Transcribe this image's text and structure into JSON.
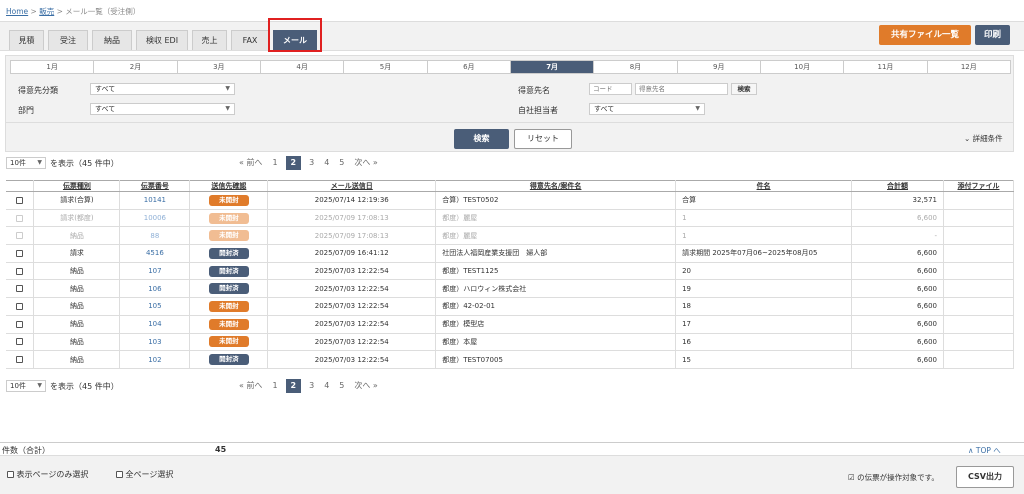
{
  "breadcrumb": {
    "home": "Home",
    "sales": "販売",
    "current": "メール一覧（受注側）"
  },
  "tabs": [
    "見積",
    "受注",
    "納品",
    "検収 EDI",
    "売上",
    "FAX",
    "メール"
  ],
  "active_tab": "メール",
  "buttons": {
    "shared_files": "共有ファイル一覧",
    "print": "印刷",
    "search": "検索",
    "reset": "リセット",
    "detail": "詳細条件",
    "csv": "CSV出力",
    "code_search": "検索"
  },
  "months": [
    "1月",
    "2月",
    "3月",
    "4月",
    "5月",
    "6月",
    "7月",
    "8月",
    "9月",
    "10月",
    "11月",
    "12月"
  ],
  "active_month": "7月",
  "filters": {
    "customer_category_label": "得意先分類",
    "customer_category_value": "すべて",
    "department_label": "部門",
    "department_value": "すべて",
    "customer_name_label": "得意先名",
    "code_placeholder": "コード",
    "name_placeholder": "得意先名",
    "staff_label": "自社担当者",
    "staff_value": "すべて"
  },
  "pagination": {
    "per_page": "10件",
    "display_label": "を表示（45 件中）",
    "prev": "« 前へ",
    "next": "次へ »",
    "pages": [
      "1",
      "2",
      "3",
      "4",
      "5"
    ],
    "current": "2"
  },
  "table": {
    "headers": [
      "伝票種別",
      "伝票番号",
      "送信先確認",
      "メール送信日",
      "得意先名/案件名",
      "件名",
      "合計額",
      "添付ファイル"
    ],
    "rows": [
      {
        "type": "請求(合算)",
        "no": "10141",
        "status": "未開封",
        "status_kind": "unread",
        "date": "2025/07/14 12:19:36",
        "customer": "合算）TEST0502",
        "subject": "合算",
        "total": "32,571",
        "attach": "",
        "dim": false
      },
      {
        "type": "請求(都度)",
        "no": "10006",
        "status": "未開封",
        "status_kind": "unread",
        "date": "2025/07/09 17:08:13",
        "customer": "都度）麗屋",
        "subject": "1",
        "total": "6,600",
        "attach": "",
        "dim": true
      },
      {
        "type": "納品",
        "no": "88",
        "status": "未開封",
        "status_kind": "unread",
        "date": "2025/07/09 17:08:13",
        "customer": "都度）麗屋",
        "subject": "1",
        "total": "-",
        "attach": "",
        "dim": true
      },
      {
        "type": "請求",
        "no": "4516",
        "status": "開封済",
        "status_kind": "read",
        "date": "2025/07/09 16:41:12",
        "customer": "社団法人福岡産業支援団　婦人部",
        "subject": "請求期間 2025年07月06~2025年08月05",
        "total": "6,600",
        "attach": "",
        "dim": false
      },
      {
        "type": "納品",
        "no": "107",
        "status": "開封済",
        "status_kind": "read",
        "date": "2025/07/03 12:22:54",
        "customer": "都度）TEST1125",
        "subject": "20",
        "total": "6,600",
        "attach": "",
        "dim": false
      },
      {
        "type": "納品",
        "no": "106",
        "status": "開封済",
        "status_kind": "read",
        "date": "2025/07/03 12:22:54",
        "customer": "都度）ハロウィン株式会社",
        "subject": "19",
        "total": "6,600",
        "attach": "",
        "dim": false
      },
      {
        "type": "納品",
        "no": "105",
        "status": "未開封",
        "status_kind": "unread",
        "date": "2025/07/03 12:22:54",
        "customer": "都度）42-02-01",
        "subject": "18",
        "total": "6,600",
        "attach": "",
        "dim": false
      },
      {
        "type": "納品",
        "no": "104",
        "status": "未開封",
        "status_kind": "unread",
        "date": "2025/07/03 12:22:54",
        "customer": "都度）模型店",
        "subject": "17",
        "total": "6,600",
        "attach": "",
        "dim": false
      },
      {
        "type": "納品",
        "no": "103",
        "status": "未開封",
        "status_kind": "unread",
        "date": "2025/07/03 12:22:54",
        "customer": "都度）本屋",
        "subject": "16",
        "total": "6,600",
        "attach": "",
        "dim": false
      },
      {
        "type": "納品",
        "no": "102",
        "status": "開封済",
        "status_kind": "read",
        "date": "2025/07/03 12:22:54",
        "customer": "都度）TEST07005",
        "subject": "15",
        "total": "6,600",
        "attach": "",
        "dim": false
      }
    ]
  },
  "footer": {
    "count_label": "件数（合計）",
    "count_value": "45",
    "top_link": "∧ TOP へ",
    "select_page": "表示ページのみ選択",
    "select_all": "全ページ選択",
    "note": "の伝票が操作対象です。"
  },
  "colors": {
    "navy": "#4a5d78",
    "orange": "#e07b2a",
    "highlight": "#e02020"
  }
}
